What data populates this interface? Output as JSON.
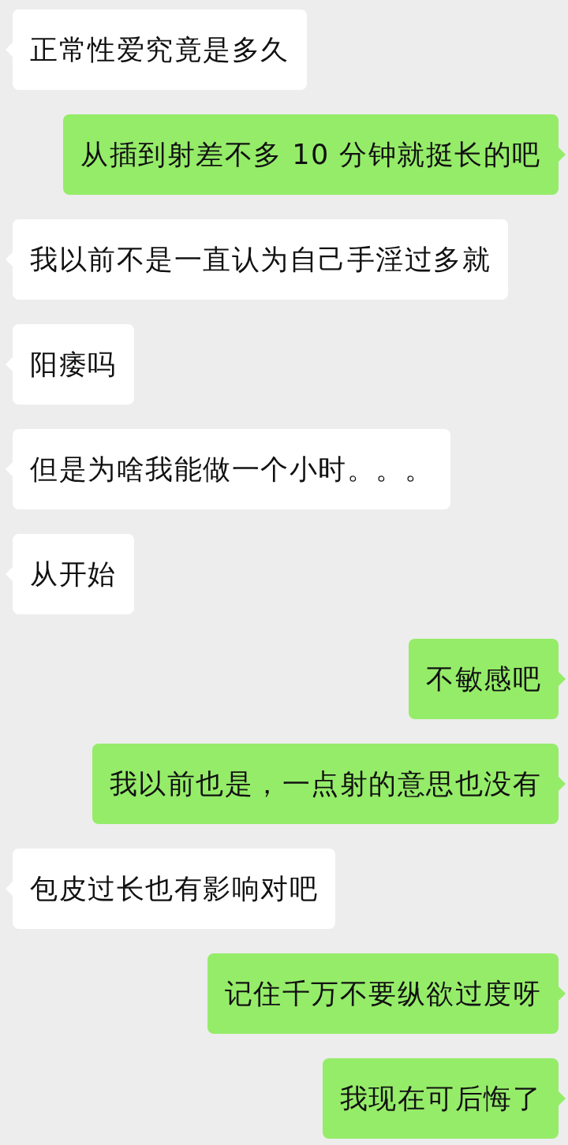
{
  "messages": [
    {
      "kind": "incoming",
      "text": "正常性爱究竟是多久"
    },
    {
      "kind": "outgoing",
      "text": "从插到射差不多 10 分钟就挺长的吧"
    },
    {
      "kind": "incoming",
      "text": "我以前不是一直认为自己手淫过多就"
    },
    {
      "kind": "incoming",
      "text": "阳痿吗"
    },
    {
      "kind": "incoming",
      "text": "但是为啥我能做一个小时。。。"
    },
    {
      "kind": "incoming",
      "text": "从开始"
    },
    {
      "kind": "outgoing",
      "text": "不敏感吧"
    },
    {
      "kind": "outgoing",
      "text": "我以前也是，一点射的意思也没有"
    },
    {
      "kind": "incoming",
      "text": "包皮过长也有影响对吧"
    },
    {
      "kind": "outgoing",
      "text": "记住千万不要纵欲过度呀"
    },
    {
      "kind": "outgoing",
      "text": "我现在可后悔了"
    }
  ]
}
